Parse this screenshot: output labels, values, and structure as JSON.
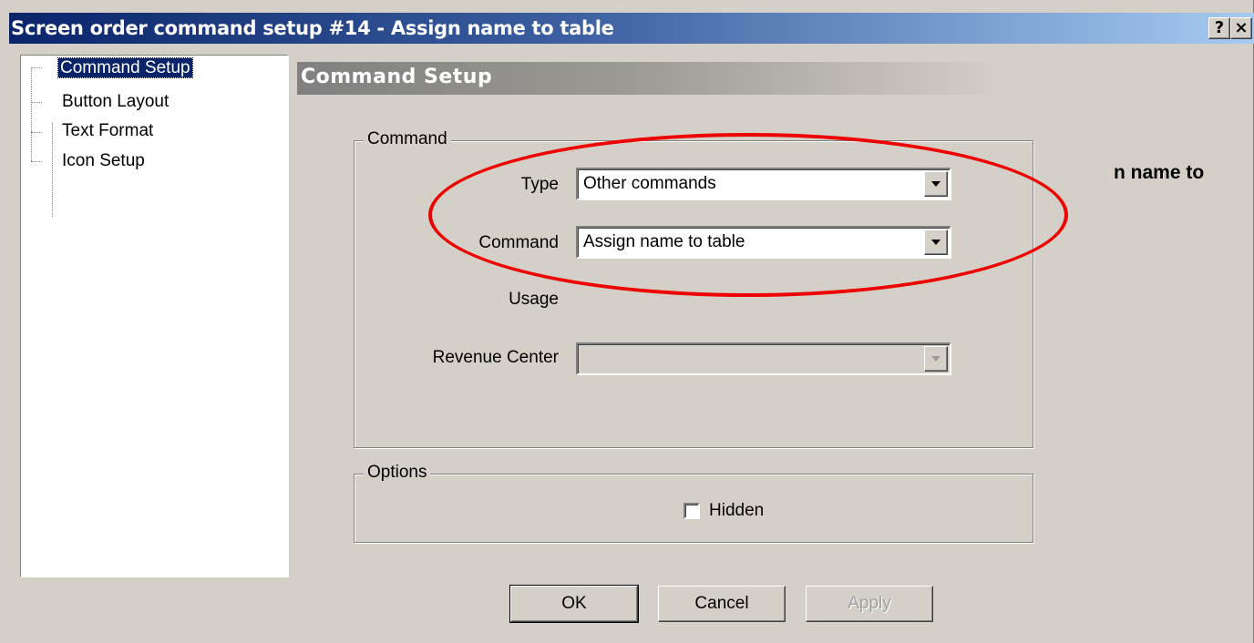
{
  "window": {
    "title": "Screen order command setup #14 - Assign name to table",
    "help_label": "?",
    "close_label": "×"
  },
  "tree": {
    "items": [
      {
        "label": "Command Setup",
        "selected": true
      },
      {
        "label": "Button Layout",
        "selected": false
      },
      {
        "label": "Text Format",
        "selected": false
      },
      {
        "label": "Icon Setup",
        "selected": false
      }
    ]
  },
  "section": {
    "title": "Command Setup"
  },
  "command_group": {
    "legend": "Command",
    "type_label": "Type",
    "type_value": "Other commands",
    "command_label": "Command",
    "command_value": "Assign name to table",
    "usage_label": "Usage",
    "revenue_center_label": "Revenue Center",
    "revenue_center_value": ""
  },
  "options_group": {
    "legend": "Options",
    "hidden_label": "Hidden",
    "hidden_checked": false
  },
  "buttons": {
    "ok": "OK",
    "cancel": "Cancel",
    "apply": "Apply"
  },
  "background_text": "n name to",
  "annotation": {
    "color": "#ee0000"
  }
}
